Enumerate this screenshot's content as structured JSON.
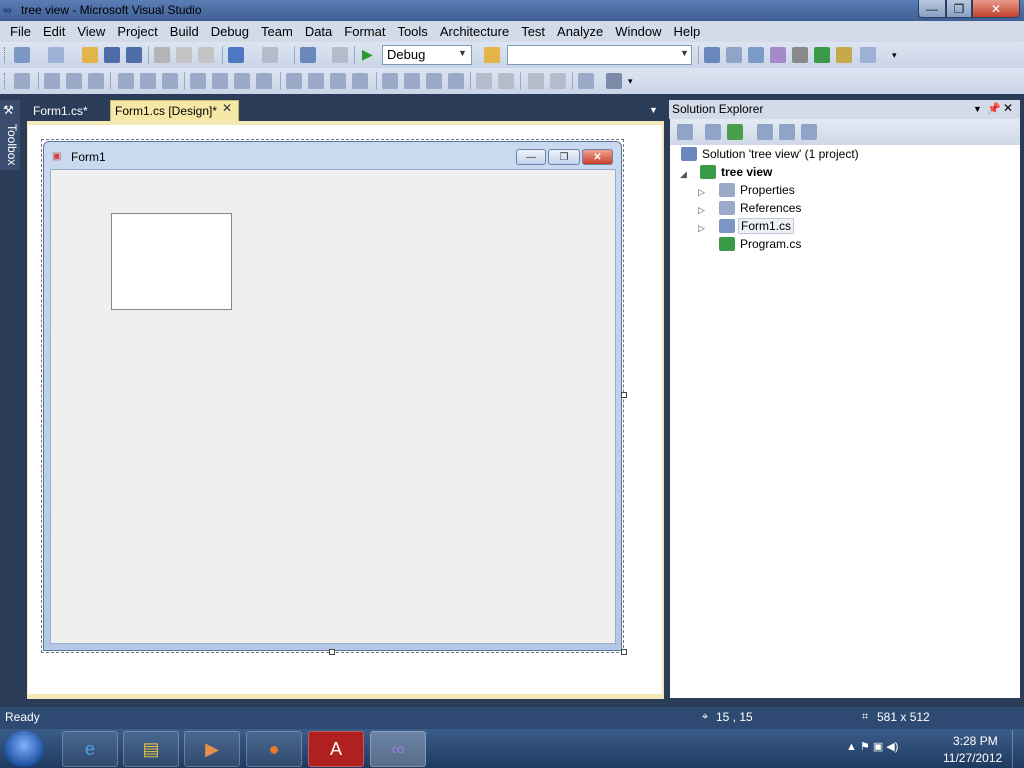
{
  "window": {
    "title": "tree view - Microsoft Visual Studio",
    "min": "—",
    "max": "❐",
    "close": "✕"
  },
  "menu": [
    "File",
    "Edit",
    "View",
    "Project",
    "Build",
    "Debug",
    "Team",
    "Data",
    "Format",
    "Tools",
    "Architecture",
    "Test",
    "Analyze",
    "Window",
    "Help"
  ],
  "toolbar": {
    "config_value": "Debug",
    "platform_value": ""
  },
  "toolbox": {
    "label": "Toolbox"
  },
  "tabs": [
    {
      "label": "Form1.cs*"
    },
    {
      "label": "Form1.cs [Design]*"
    }
  ],
  "designer": {
    "form_title": "Form1",
    "form_min": "—",
    "form_max": "❐",
    "form_close": "✕"
  },
  "solution_explorer": {
    "title": "Solution Explorer",
    "items": [
      {
        "label": "Solution 'tree view' (1 project)",
        "icon": "solution-icon"
      },
      {
        "label": "tree view",
        "icon": "csharp-project-icon"
      },
      {
        "label": "Properties",
        "icon": "properties-folder-icon"
      },
      {
        "label": "References",
        "icon": "references-folder-icon"
      },
      {
        "label": "Form1.cs",
        "icon": "form-file-icon"
      },
      {
        "label": "Program.cs",
        "icon": "csharp-file-icon"
      }
    ]
  },
  "status": {
    "text": "Ready",
    "position": "15 , 15",
    "size": "581 x 512"
  },
  "taskbar": {
    "apps": [
      "internet-explorer-icon",
      "file-explorer-icon",
      "media-player-icon",
      "firefox-icon",
      "adobe-reader-icon",
      "visual-studio-icon"
    ],
    "time": "3:28 PM",
    "date": "11/27/2012"
  },
  "colors": {
    "accent": "#2b3c59",
    "tab_active": "#f6e9a8",
    "menubar": "#d3dbe9"
  }
}
